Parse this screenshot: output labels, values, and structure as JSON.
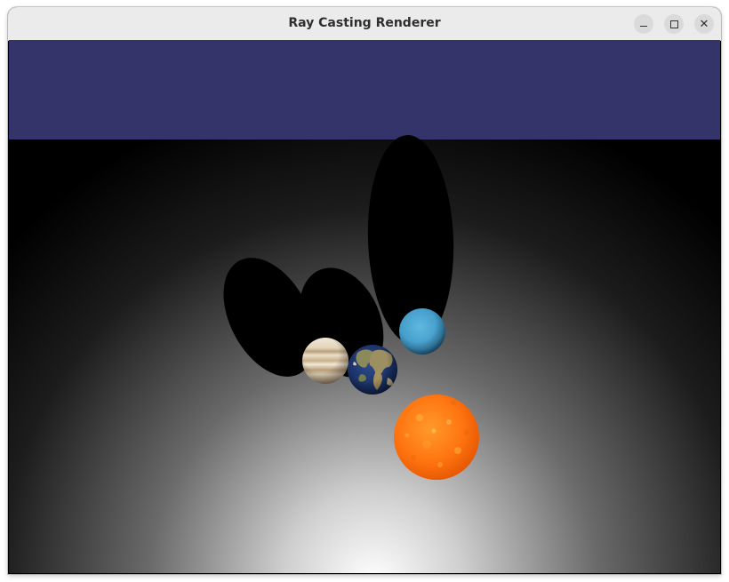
{
  "window": {
    "title": "Ray Casting Renderer",
    "controls": {
      "minimize": "minimize",
      "maximize": "maximize",
      "close": "close"
    }
  },
  "scene": {
    "sky_color": "#35346a",
    "floor_highlight_color": "#ffffff",
    "floor_dark_color": "#000000",
    "bodies": [
      "jupiter",
      "earth",
      "uranus",
      "sun"
    ],
    "sun_color": "#ff7a10",
    "uranus_color": "#4aa6d2",
    "earth_ocean_color": "#1b3266",
    "jupiter_color": "#e2d3b8"
  }
}
